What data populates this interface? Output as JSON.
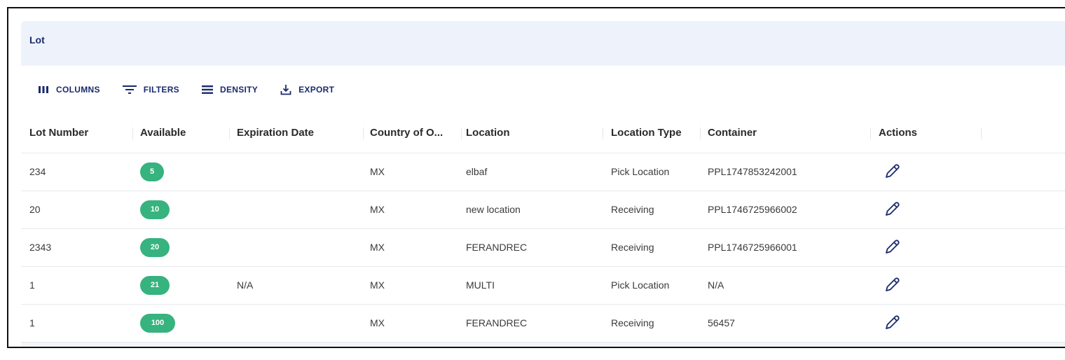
{
  "panel": {
    "title": "Lot"
  },
  "toolbar": {
    "columns": "COLUMNS",
    "filters": "FILTERS",
    "density": "DENSITY",
    "export": "EXPORT"
  },
  "columns": [
    "Lot Number",
    "Available",
    "Expiration Date",
    "Country of O...",
    "Location",
    "Location Type",
    "Container",
    "Actions"
  ],
  "rows": [
    {
      "lot": "234",
      "available": "5",
      "expiration": "",
      "country": "MX",
      "location": "elbaf",
      "location_type": "Pick Location",
      "container": "PPL1747853242001"
    },
    {
      "lot": "20",
      "available": "10",
      "expiration": "",
      "country": "MX",
      "location": "new location",
      "location_type": "Receiving",
      "container": "PPL1746725966002"
    },
    {
      "lot": "2343",
      "available": "20",
      "expiration": "",
      "country": "MX",
      "location": "FERANDREC",
      "location_type": "Receiving",
      "container": "PPL1746725966001"
    },
    {
      "lot": "1",
      "available": "21",
      "expiration": "N/A",
      "country": "MX",
      "location": "MULTI",
      "location_type": "Pick Location",
      "container": "N/A"
    },
    {
      "lot": "1",
      "available": "100",
      "expiration": "",
      "country": "MX",
      "location": "FERANDREC",
      "location_type": "Receiving",
      "container": "56457"
    }
  ],
  "colors": {
    "accent": "#1a2a6c",
    "badge": "#36b37e",
    "header_bg": "#eef3fb"
  },
  "icons": {
    "columns": "columns-icon",
    "filters": "filter-icon",
    "density": "density-icon",
    "export": "export-icon",
    "edit": "pencil-icon"
  }
}
